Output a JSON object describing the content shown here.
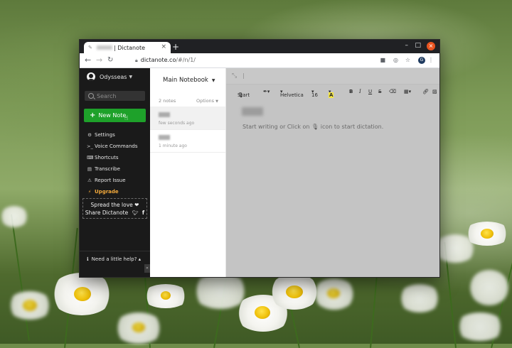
{
  "browser": {
    "tab_title": "| Dictanote",
    "new_tab_label": "+",
    "close_tab_label": "×",
    "minimize_label": "–",
    "maximize_label": "□",
    "close_window_label": "×",
    "url_host": "dictanote.co",
    "url_path": "/#/n/1/",
    "profile_initial": "G"
  },
  "sidebar": {
    "username": "Odysseas",
    "search_placeholder": "Search",
    "new_note_label": "New Note",
    "menu": [
      {
        "icon": "gear-icon",
        "glyph": "⚙",
        "label": "Settings"
      },
      {
        "icon": "terminal-icon",
        "glyph": ">_",
        "label": "Voice Commands"
      },
      {
        "icon": "keyboard-icon",
        "glyph": "⌨",
        "label": "Shortcuts"
      },
      {
        "icon": "document-icon",
        "glyph": "▤",
        "label": "Transcribe"
      },
      {
        "icon": "warning-icon",
        "glyph": "⚠",
        "label": "Report Issue"
      },
      {
        "icon": "bolt-icon",
        "glyph": "⚡",
        "label": "Upgrade"
      }
    ],
    "spread_line1": "Spread the love ❤",
    "spread_line2": "Share Dictanote",
    "help_label": "Need a little help? ▴",
    "collapse_label": "«"
  },
  "notes": {
    "notebook_name": "Main Notebook",
    "count_label": "2 notes",
    "options_label": "Options",
    "items": [
      {
        "time": "few seconds ago"
      },
      {
        "time": "1 minute ago"
      }
    ]
  },
  "editor": {
    "toolbar": {
      "start_label": "Start",
      "font_label": "Helvetica",
      "size_label": "16",
      "highlight_label": "A",
      "bold_label": "B",
      "italic_label": "I",
      "underline_label": "U",
      "strike_label": "S"
    },
    "placeholder_prefix": "Start writing or Click on",
    "placeholder_suffix": "icon to start dictation."
  },
  "colors": {
    "accent_green": "#1ea12a",
    "upgrade_orange": "#f2a93b",
    "sidebar_bg": "#1a1a1a",
    "editor_bg": "#c4c4c4"
  }
}
